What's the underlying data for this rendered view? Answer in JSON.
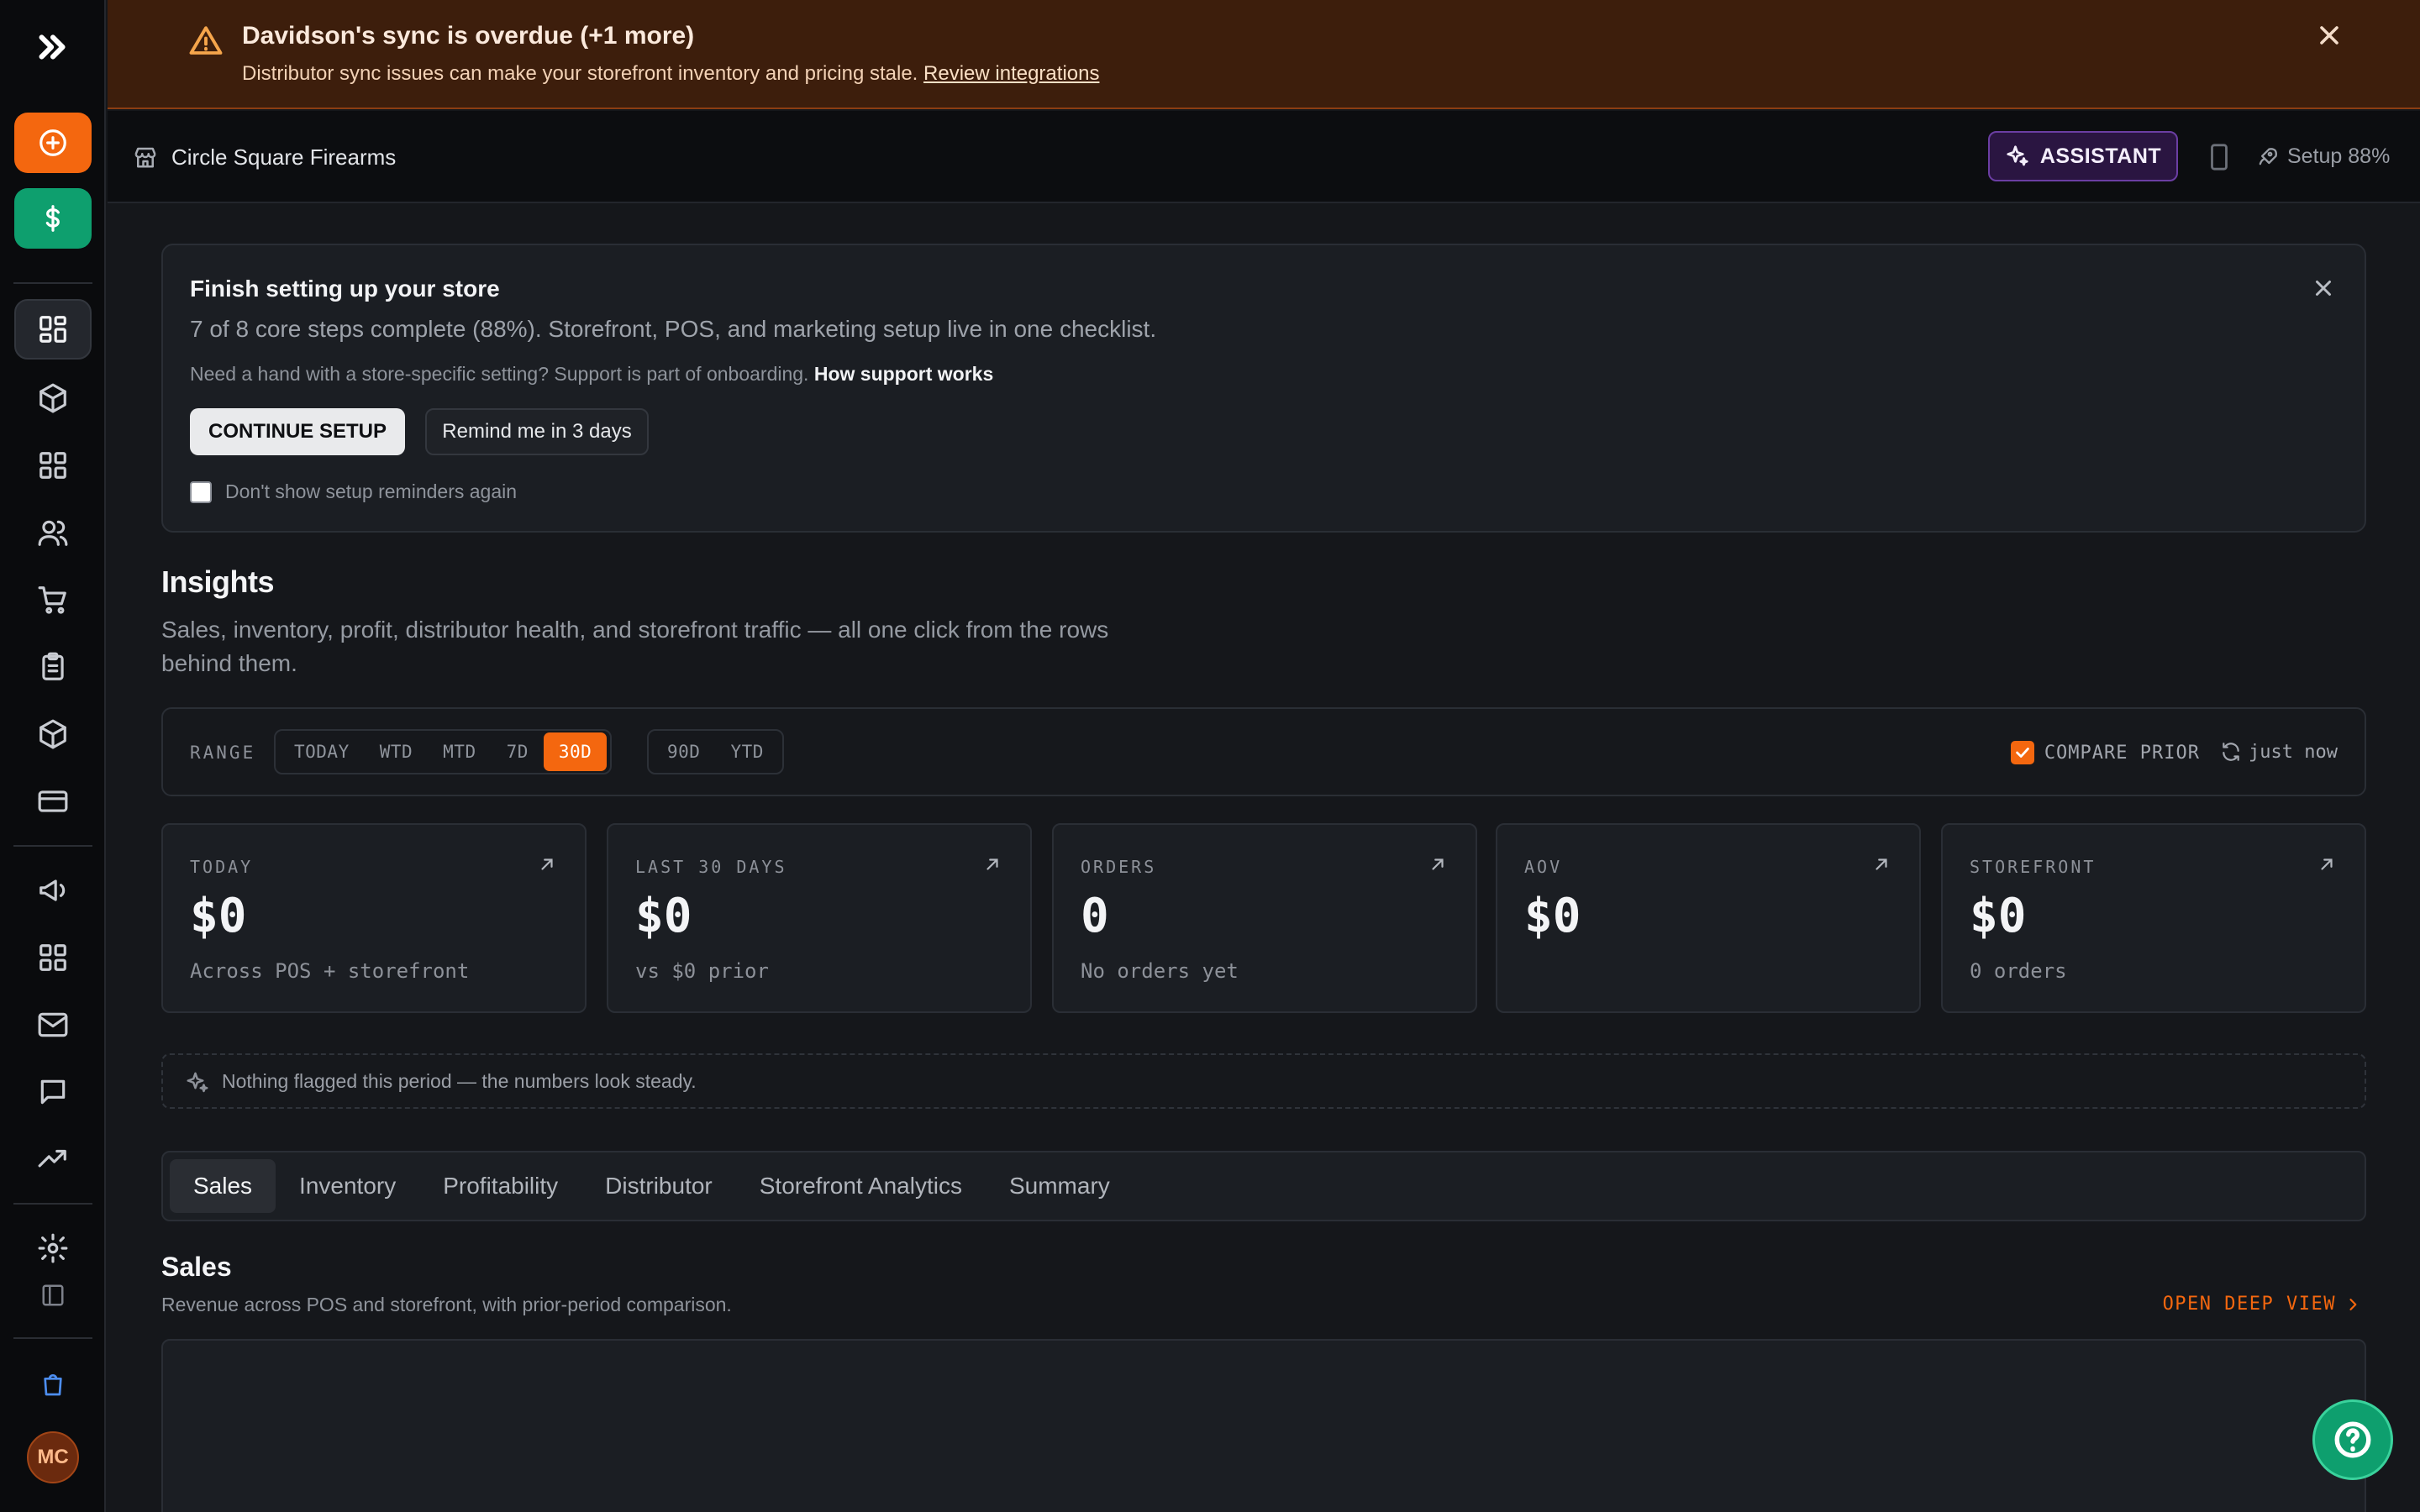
{
  "banner": {
    "title": "Davidson's sync is overdue (+1 more)",
    "text": "Distributor sync issues can make your storefront inventory and pricing stale.",
    "link": "Review integrations"
  },
  "topbar": {
    "store_name": "Circle Square Firearms",
    "assistant_label": "ASSISTANT",
    "setup_progress": "Setup 88%"
  },
  "setup_card": {
    "title": "Finish setting up your store",
    "subtitle": "7 of 8 core steps complete (88%). Storefront, POS, and marketing setup live in one checklist.",
    "help_text": "Need a hand with a store-specific setting? Support is part of onboarding.",
    "help_link": "How support works",
    "continue_label": "CONTINUE SETUP",
    "remind_label": "Remind me in 3 days",
    "dont_show_label": "Don't show setup reminders again"
  },
  "insights": {
    "title": "Insights",
    "description": "Sales, inventory, profit, distributor health, and storefront traffic — all one click from the rows behind them."
  },
  "range": {
    "label": "RANGE",
    "group1": [
      "TODAY",
      "WTD",
      "MTD",
      "7D",
      "30D"
    ],
    "group2": [
      "90D",
      "YTD"
    ],
    "selected": "30D",
    "compare_label": "COMPARE PRIOR",
    "compare_checked": true,
    "refresh_label": "just now"
  },
  "kpis": [
    {
      "label": "TODAY",
      "value": "$0",
      "note": "Across POS + storefront"
    },
    {
      "label": "LAST 30 DAYS",
      "value": "$0",
      "note": "vs $0 prior"
    },
    {
      "label": "ORDERS",
      "value": "0",
      "note": "No orders yet"
    },
    {
      "label": "AOV",
      "value": "$0",
      "note": ""
    },
    {
      "label": "STOREFRONT",
      "value": "$0",
      "note": "0 orders"
    }
  ],
  "flag_text": "Nothing flagged this period — the numbers look steady.",
  "tabs": [
    "Sales",
    "Inventory",
    "Profitability",
    "Distributor",
    "Storefront Analytics",
    "Summary"
  ],
  "active_tab": "Sales",
  "sales": {
    "title": "Sales",
    "description": "Revenue across POS and storefront, with prior-period comparison.",
    "deep_link": "OPEN DEEP VIEW"
  },
  "user": {
    "initials": "MC"
  },
  "colors": {
    "accent": "#f4670f",
    "success": "#0e9f6e",
    "assistant": "#6b3ea3"
  }
}
